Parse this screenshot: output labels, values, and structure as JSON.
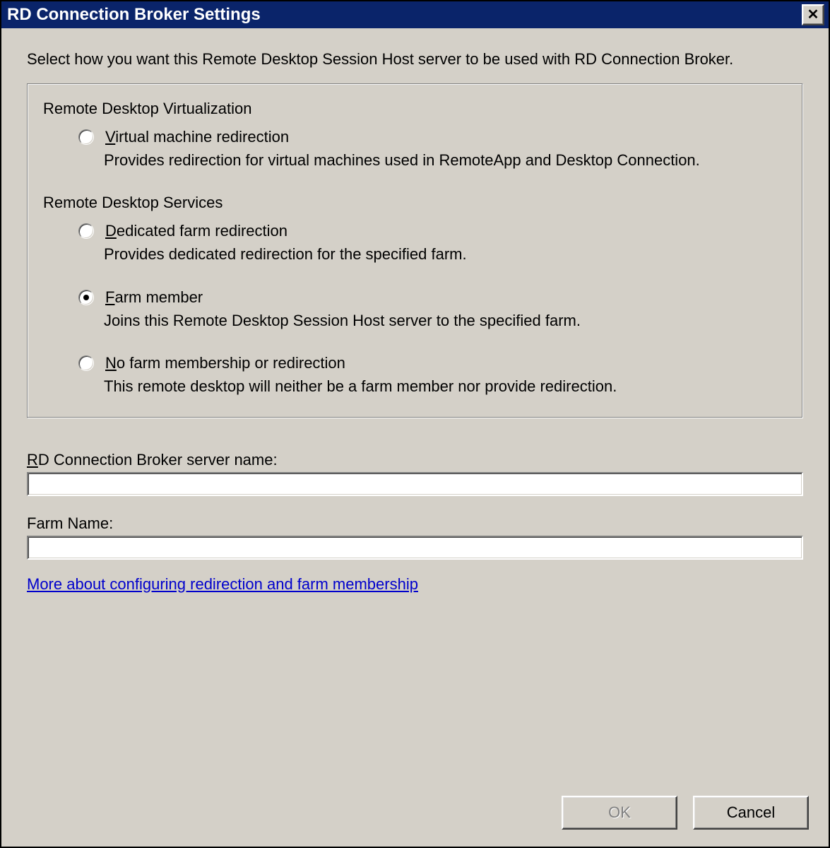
{
  "window": {
    "title": "RD Connection Broker Settings",
    "close_glyph": "✕"
  },
  "intro": "Select how you want this Remote Desktop Session Host server to be used with RD Connection Broker.",
  "section1": {
    "heading": "Remote Desktop Virtualization",
    "opt1": {
      "label": "Virtual machine redirection",
      "accel": "V",
      "desc": "Provides redirection for virtual machines used in RemoteApp and Desktop Connection.",
      "selected": false
    }
  },
  "section2": {
    "heading": "Remote Desktop Services",
    "opt1": {
      "label": "Dedicated farm redirection",
      "accel": "D",
      "desc": "Provides dedicated redirection for the specified farm.",
      "selected": false
    },
    "opt2": {
      "label": "Farm member",
      "accel": "F",
      "desc": "Joins this Remote Desktop Session Host server to the specified farm.",
      "selected": true
    },
    "opt3": {
      "label": "No farm membership or redirection",
      "accel": "N",
      "desc": "This remote desktop will neither be a farm member nor provide redirection.",
      "selected": false
    }
  },
  "fields": {
    "broker_server_label": "RD Connection Broker server name:",
    "broker_server_accel": "R",
    "broker_server_value": "",
    "farm_name_label": "Farm Name:",
    "farm_name_value": ""
  },
  "link_text": "More about configuring redirection and farm membership",
  "buttons": {
    "ok": "OK",
    "cancel": "Cancel",
    "ok_enabled": false
  }
}
